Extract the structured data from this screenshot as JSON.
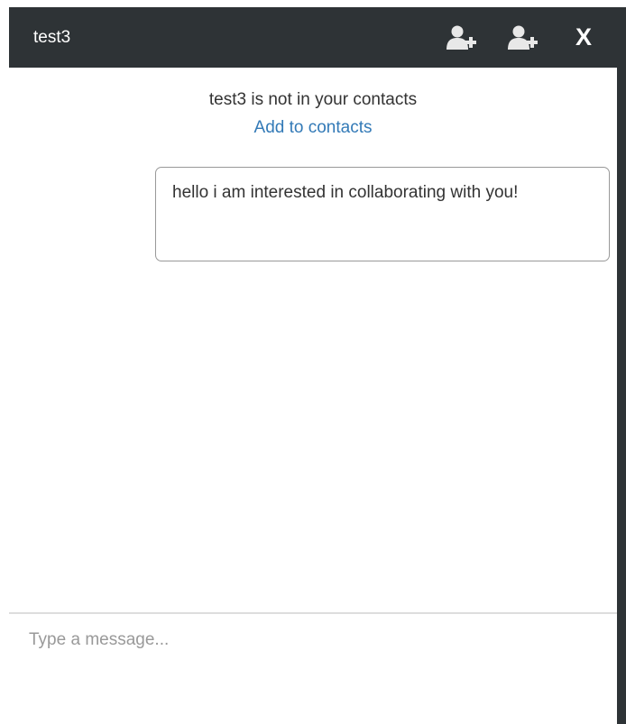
{
  "header": {
    "title": "test3",
    "icons": [
      "add-contact-icon",
      "add-contact-icon"
    ],
    "close_label": "X",
    "background": "#2e3336"
  },
  "notice": {
    "text": "test3 is not in your contacts",
    "link_label": "Add to contacts",
    "link_color": "#337ab7"
  },
  "messages": [
    {
      "text": "hello i am interested in collaborating with you!"
    }
  ],
  "composer": {
    "placeholder": "Type a message...",
    "value": ""
  }
}
